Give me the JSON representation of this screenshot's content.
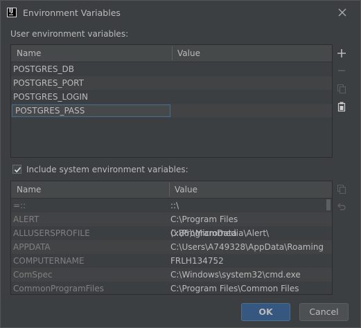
{
  "window": {
    "title": "Environment Variables",
    "app_icon_text": "IJ"
  },
  "user_section": {
    "label": "User environment variables:",
    "columns": [
      "Name",
      "Value"
    ],
    "rows": [
      {
        "name": "POSTGRES_DB",
        "value": ""
      },
      {
        "name": "POSTGRES_PORT",
        "value": ""
      },
      {
        "name": "POSTGRES_LOGIN",
        "value": ""
      }
    ],
    "editing_row": {
      "name": "POSTGRES_PASS"
    },
    "toolbar": [
      "add-icon",
      "remove-icon",
      "copy-icon",
      "paste-icon"
    ]
  },
  "system_section": {
    "checkbox_label": "Include system environment variables:",
    "checked": true,
    "columns": [
      "Name",
      "Value"
    ],
    "rows": [
      {
        "name": "=::",
        "value": "::\\"
      },
      {
        "name": "ALERT",
        "value": "C:\\Program Files (x86)\\Micromedia\\Alert\\"
      },
      {
        "name": "ALLUSERSPROFILE",
        "value": "C:\\ProgramData"
      },
      {
        "name": "APPDATA",
        "value": "C:\\Users\\A749328\\AppData\\Roaming"
      },
      {
        "name": "COMPUTERNAME",
        "value": "FRLH134752"
      },
      {
        "name": "ComSpec",
        "value": "C:\\Windows\\system32\\cmd.exe"
      },
      {
        "name": "CommonProgramFiles",
        "value": "C:\\Program Files\\Common Files"
      }
    ],
    "toolbar": [
      "copy-icon",
      "undo-icon"
    ]
  },
  "buttons": {
    "ok": "OK",
    "cancel": "Cancel"
  },
  "colors": {
    "accent": "#365880",
    "background": "#3c3f41",
    "text": "#bbbbbb",
    "muted_text": "#808080"
  }
}
